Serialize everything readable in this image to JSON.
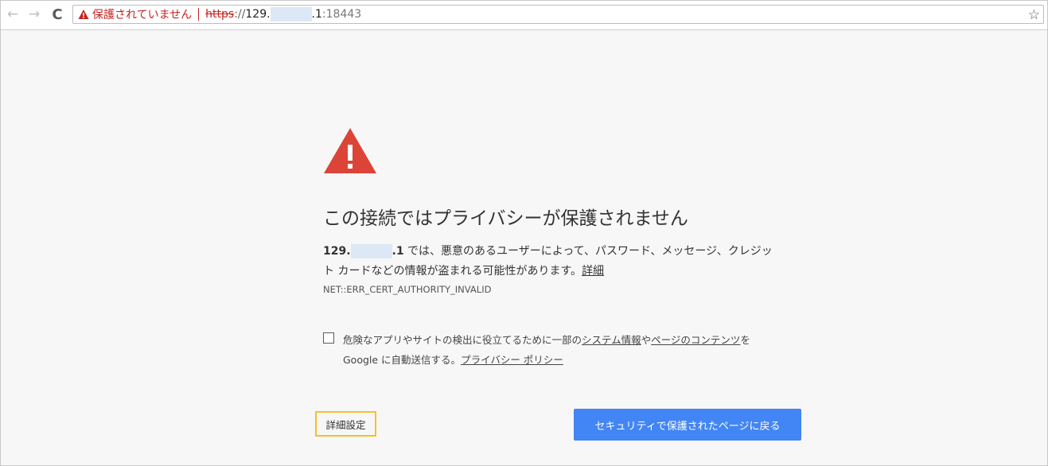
{
  "browser": {
    "nav_back": "←",
    "nav_forward": "→",
    "reload": "C",
    "not_secure_label": "保護されていません",
    "url_scheme": "https",
    "url_sep": "://",
    "url_host_prefix": "129.",
    "url_host_suffix": ".1",
    "url_port": ":18443",
    "bookmark_star": "☆"
  },
  "interstitial": {
    "heading": "この接続ではプライバシーが保護されません",
    "host_prefix": "129.",
    "host_suffix": ".1",
    "description_line1": " では、悪意のあるユーザーによって、パスワード、メッセージ、クレジッ",
    "description_line2": "ト カードなどの情報が盗まれる可能性があります。",
    "details_link": "詳細",
    "error_code": "NET::ERR_CERT_AUTHORITY_INVALID",
    "safe_browsing": {
      "checked": false,
      "text_part1": "危険なアプリやサイトの検出に役立てるために一部の",
      "link_system_info": "システム情報",
      "text_part2": "や",
      "link_page_content": "ページのコンテンツ",
      "text_part3": "を",
      "text_line2": "Google に自動送信する。",
      "link_privacy_policy": "プライバシー ポリシー"
    },
    "advanced_button": "詳細設定",
    "back_button": "セキュリティで保護されたページに戻る"
  },
  "colors": {
    "warning_red": "#db4437",
    "primary_button": "#4285f4",
    "highlight_border": "#f5c02d",
    "not_secure_text": "#c5221f"
  },
  "icons": [
    "back-arrow-icon",
    "forward-arrow-icon",
    "reload-icon",
    "warning-triangle-icon",
    "star-icon"
  ]
}
